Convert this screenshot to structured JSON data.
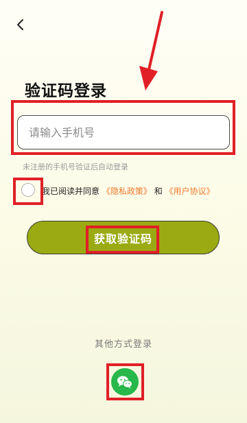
{
  "title": "验证码登录",
  "phone_input": {
    "placeholder": "请输入手机号",
    "value": ""
  },
  "hint": "未注册的手机号验证后自动登录",
  "agreement": {
    "prefix": "我已阅读并同意",
    "privacy_link": "《隐私政策》",
    "conjunction": "和",
    "terms_link": "《用户协议》",
    "checked": false
  },
  "get_code_button": "获取验证码",
  "other_methods_label": "其他方式登录",
  "icons": {
    "back": "chevron-left-icon",
    "wechat": "wechat-icon"
  },
  "colors": {
    "accent": "#9aaa12",
    "link": "#f07a2c",
    "highlight": "#e01f26",
    "wechat": "#27b74a"
  }
}
